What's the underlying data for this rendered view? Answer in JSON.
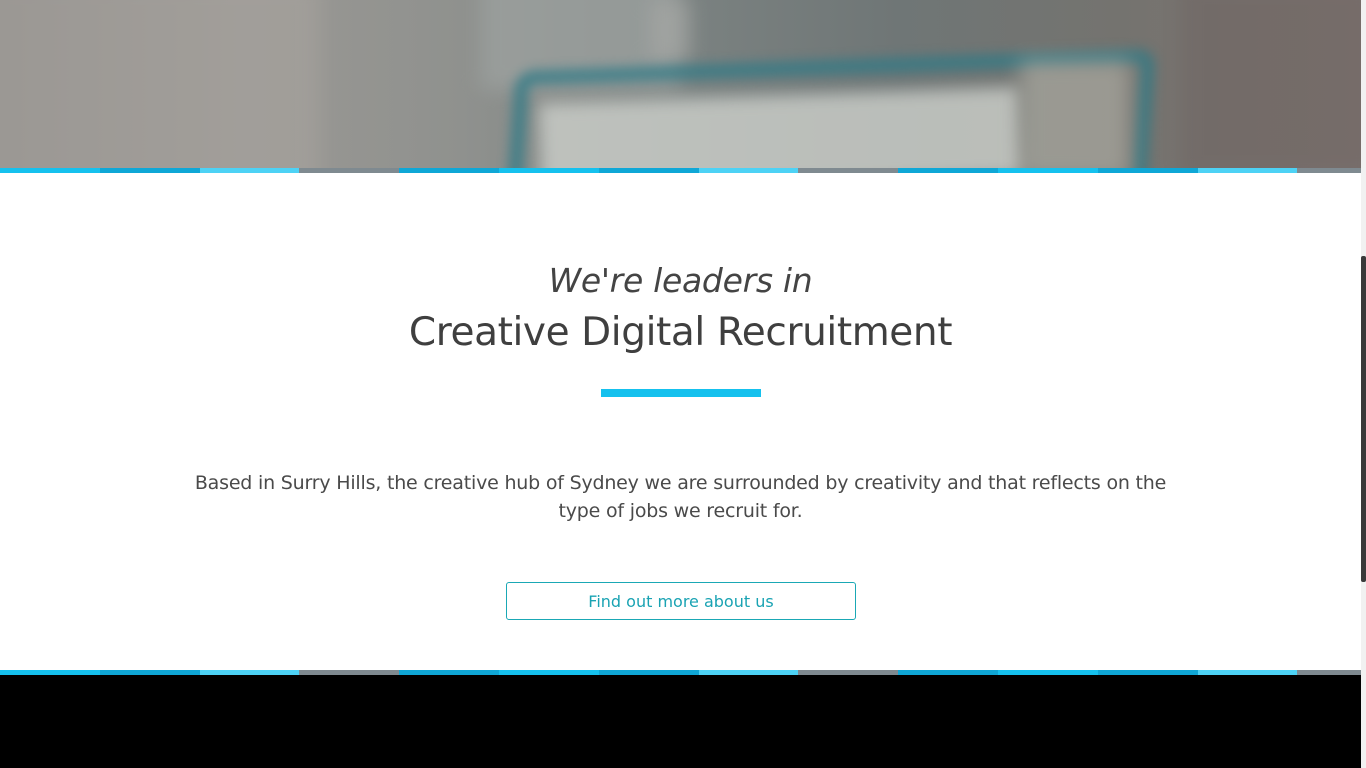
{
  "section": {
    "eyebrow": "We're leaders in",
    "headline": "Creative Digital Recruitment",
    "body": "Based in Surry Hills, the creative hub of Sydney we are surrounded by creativity and that reflects on the type of jobs we recruit for.",
    "cta_label": "Find out more about us"
  },
  "colors": {
    "accent": "#15c1ee",
    "cta": "#1aa3b3",
    "text": "#3f3f3f",
    "footer": "#000000"
  },
  "stripe_colors": [
    "#15c1ee",
    "#0fa7d6",
    "#4dd2f5",
    "#7f8a90",
    "#0fa7d6",
    "#15c1ee",
    "#0fa7d6",
    "#4dd2f5",
    "#7f8a90",
    "#0fa7d6",
    "#15c1ee",
    "#0fa7d6",
    "#4dd2f5",
    "#7f8a90"
  ]
}
